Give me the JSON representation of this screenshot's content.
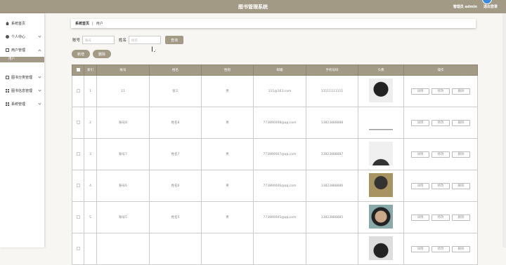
{
  "header": {
    "title": "图书管理系统",
    "user": "管理员 admin",
    "logout": "退出登录"
  },
  "sidebar": {
    "items": [
      {
        "label": "系统首页"
      },
      {
        "label": "个人中心"
      },
      {
        "label": "用户管理"
      },
      {
        "label": "图书分类管理"
      },
      {
        "label": "图书信息管理"
      },
      {
        "label": "系统管理"
      }
    ],
    "submenu": {
      "label": "用户"
    }
  },
  "breadcrumb": {
    "home": "系统首页",
    "sep": "|",
    "current": "用户"
  },
  "search": {
    "account_label": "账号",
    "account_placeholder": "账号",
    "name_label": "姓名",
    "name_placeholder": "姓名",
    "query": "查询"
  },
  "actions": {
    "add": "新增",
    "delete": "删除"
  },
  "table": {
    "headers": [
      "",
      "索引",
      "账号",
      "姓名",
      "性别",
      "邮箱",
      "手机号码",
      "头像",
      "操作"
    ],
    "op_labels": {
      "detail": "详情",
      "edit": "修改",
      "delete": "删除"
    },
    "rows": [
      {
        "index": "1",
        "account": "11",
        "name": "张三",
        "gender": "男",
        "email": "111@163.com",
        "phone": "13111111111"
      },
      {
        "index": "2",
        "account": "账号8",
        "name": "姓名8",
        "gender": "男",
        "email": "773890008@qq.com",
        "phone": "13823888888"
      },
      {
        "index": "3",
        "account": "账号7",
        "name": "姓名7",
        "gender": "男",
        "email": "773890007@qq.com",
        "phone": "13823888887"
      },
      {
        "index": "4",
        "account": "账号6",
        "name": "姓名6",
        "gender": "男",
        "email": "773890006@qq.com",
        "phone": "13823888886"
      },
      {
        "index": "5",
        "account": "账号5",
        "name": "姓名5",
        "gender": "男",
        "email": "773890005@qq.com",
        "phone": "13823888885"
      },
      {
        "index": "",
        "account": "",
        "name": "",
        "gender": "",
        "email": "",
        "phone": ""
      }
    ]
  }
}
